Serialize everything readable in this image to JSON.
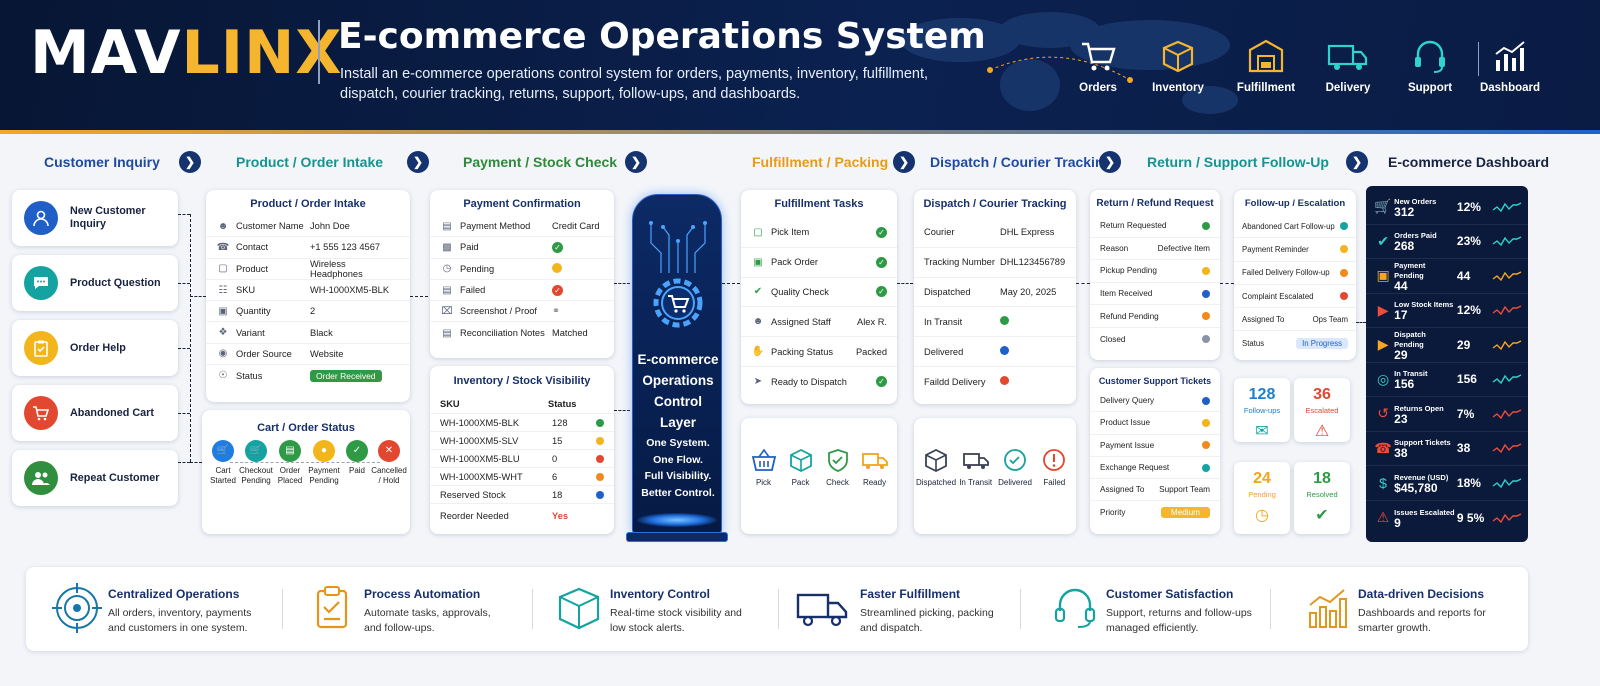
{
  "header": {
    "logo_a": "MAV",
    "logo_b": "LINX",
    "title": "E-commerce Operations System",
    "subtitle": "Install an e-commerce operations control system for orders, payments, inventory, fulfillment, dispatch, courier tracking, returns, support, follow-ups, and dashboards.",
    "icons": [
      {
        "label": "Orders",
        "icon": "cart-icon"
      },
      {
        "label": "Inventory",
        "icon": "box-icon"
      },
      {
        "label": "Fulfillment",
        "icon": "warehouse-icon"
      },
      {
        "label": "Delivery",
        "icon": "truck-icon"
      },
      {
        "label": "Support",
        "icon": "headset-icon"
      },
      {
        "label": "Dashboard",
        "icon": "bar-chart-icon"
      }
    ]
  },
  "stages": [
    {
      "label": "Customer Inquiry"
    },
    {
      "label": "Product / Order Intake"
    },
    {
      "label": "Payment / Stock Check"
    },
    {
      "label": "Fulfillment / Packing"
    },
    {
      "label": "Dispatch / Courier Tracking"
    },
    {
      "label": "Return / Support Follow-Up"
    },
    {
      "label": "E-commerce Dashboard"
    }
  ],
  "inquiry": [
    {
      "label": "New Customer Inquiry",
      "color": "#1f5fc7"
    },
    {
      "label": "Product Question",
      "color": "#14a3a0"
    },
    {
      "label": "Order Help",
      "color": "#f2b51b"
    },
    {
      "label": "Abandoned Cart",
      "color": "#e2472f"
    },
    {
      "label": "Repeat Customer",
      "color": "#2f8f3e"
    }
  ],
  "intake": {
    "title": "Product / Order Intake",
    "rows": [
      {
        "label": "Customer Name",
        "value": "John Doe"
      },
      {
        "label": "Contact",
        "value": "+1 555 123 4567"
      },
      {
        "label": "Product",
        "value": "Wireless Headphones"
      },
      {
        "label": "SKU",
        "value": "WH-1000XM5-BLK"
      },
      {
        "label": "Quantity",
        "value": "2"
      },
      {
        "label": "Variant",
        "value": "Black"
      },
      {
        "label": "Order Source",
        "value": "Website"
      },
      {
        "label": "Status",
        "value": "Order Received"
      }
    ]
  },
  "cart": {
    "title": "Cart / Order Status",
    "steps": [
      {
        "label": "Cart Started",
        "color": "#1f7ce0"
      },
      {
        "label": "Checkout Pending",
        "color": "#14a3a0"
      },
      {
        "label": "Order Placed",
        "color": "#2f9a46"
      },
      {
        "label": "Payment Pending",
        "color": "#f2b51b"
      },
      {
        "label": "Paid",
        "color": "#2f9a46"
      },
      {
        "label": "Cancelled / Hold",
        "color": "#e2472f"
      }
    ]
  },
  "payment": {
    "title": "Payment Confirmation",
    "rows": [
      {
        "label": "Payment Method",
        "value": "Credit Card"
      },
      {
        "label": "Paid",
        "value": ""
      },
      {
        "label": "Pending",
        "value": ""
      },
      {
        "label": "Failed",
        "value": ""
      },
      {
        "label": "Screenshot / Proof",
        "value": ""
      },
      {
        "label": "Reconciliation Notes",
        "value": "Matched"
      }
    ]
  },
  "inventory": {
    "title": "Inventory / Stock Visibility",
    "col_sku": "SKU",
    "col_status": "Status",
    "rows": [
      {
        "sku": "WH-1000XM5-BLK",
        "status": "128",
        "color": "#2f9a46"
      },
      {
        "sku": "WH-1000XM5-SLV",
        "status": "15",
        "color": "#f2b51b"
      },
      {
        "sku": "WH-1000XM5-BLU",
        "status": "0",
        "color": "#e2472f"
      },
      {
        "sku": "WH-1000XM5-WHT",
        "status": "6",
        "color": "#f28a1b"
      },
      {
        "sku": "Reserved Stock",
        "status": "18",
        "color": "#1f5fc7"
      }
    ],
    "reorder_label": "Reorder Needed",
    "reorder_value": "Yes"
  },
  "core": {
    "title": "E-commerce Operations Control Layer",
    "tagline": [
      "One System.",
      "One Flow.",
      "Full Visibility.",
      "Better Control."
    ]
  },
  "fulfillment": {
    "title": "Fulfillment Tasks",
    "rows": [
      {
        "label": "Pick Item",
        "value": ""
      },
      {
        "label": "Pack Order",
        "value": ""
      },
      {
        "label": "Quality Check",
        "value": ""
      },
      {
        "label": "Assigned Staff",
        "value": "Alex R."
      },
      {
        "label": "Packing Status",
        "value": "Packed"
      },
      {
        "label": "Ready to Dispatch",
        "value": ""
      }
    ],
    "steps": [
      "Pick",
      "Pack",
      "Check",
      "Ready"
    ]
  },
  "dispatch": {
    "title": "Dispatch / Courier Tracking",
    "rows": [
      {
        "label": "Courier",
        "value": "DHL Express"
      },
      {
        "label": "Tracking Number",
        "value": "DHL123456789"
      },
      {
        "label": "Dispatched",
        "value": "May 20, 2025"
      },
      {
        "label": "In Transit",
        "value": ""
      },
      {
        "label": "Delivered",
        "value": ""
      },
      {
        "label": "Faildd Delivery",
        "value": ""
      }
    ],
    "steps": [
      "Dispatched",
      "In Transit",
      "Delivered",
      "Failed"
    ]
  },
  "returns": {
    "title": "Return / Refund Request",
    "rows": [
      {
        "label": "Return Requested",
        "value": "",
        "color": "#2f9a46"
      },
      {
        "label": "Reason",
        "value": "Defective Item",
        "color": ""
      },
      {
        "label": "Pickup Pending",
        "value": "",
        "color": "#f2b51b"
      },
      {
        "label": "Item Received",
        "value": "",
        "color": "#1f5fc7"
      },
      {
        "label": "Refund Pending",
        "value": "",
        "color": "#f28a1b"
      },
      {
        "label": "Closed",
        "value": "",
        "color": "#8a93a6"
      }
    ]
  },
  "support": {
    "title": "Customer Support Tickets",
    "rows": [
      {
        "label": "Delivery Query",
        "value": "",
        "color": "#1f5fc7"
      },
      {
        "label": "Product Issue",
        "value": "",
        "color": "#f2b51b"
      },
      {
        "label": "Payment Issue",
        "value": "",
        "color": "#f28a1b"
      },
      {
        "label": "Exchange Request",
        "value": "",
        "color": "#14a3a0"
      },
      {
        "label": "Assigned To",
        "value": "Support Team",
        "color": ""
      },
      {
        "label": "Priority",
        "value": "Medium",
        "color": ""
      }
    ]
  },
  "followup": {
    "title": "Follow-up / Escalation",
    "rows": [
      {
        "label": "Abandoned Cart Follow-up",
        "value": "",
        "color": "#14a3a0"
      },
      {
        "label": "Payment Reminder",
        "value": "",
        "color": "#f2b51b"
      },
      {
        "label": "Failed Delivery Follow-up",
        "value": "",
        "color": "#f28a1b"
      },
      {
        "label": "Complaint Escalated",
        "value": "",
        "color": "#e2472f"
      },
      {
        "label": "Assigned To",
        "value": "Ops Team",
        "color": ""
      },
      {
        "label": "Status",
        "value": "In Progress",
        "color": ""
      }
    ]
  },
  "kpis": [
    {
      "value": "128",
      "label": "Follow-ups",
      "color": "#1a7fd0"
    },
    {
      "value": "36",
      "label": "Escalated",
      "color": "#e2472f"
    },
    {
      "value": "24",
      "label": "Pending",
      "color": "#f2a41b"
    },
    {
      "value": "18",
      "label": "Resolved",
      "color": "#2f9a46"
    }
  ],
  "dashboard": [
    {
      "label": "New Orders",
      "value": "312",
      "pct": "12%",
      "icon": "cart-icon",
      "color": "#2fd3c9"
    },
    {
      "label": "Orders Paid",
      "value": "268",
      "pct": "23%",
      "icon": "check-circle-icon",
      "color": "#2fd3c9"
    },
    {
      "label": "Payment Pending",
      "value": "44",
      "pct": "44",
      "icon": "box-icon",
      "color": "#f5a623"
    },
    {
      "label": "Low Stock Items",
      "value": "17",
      "pct": "12%",
      "icon": "truck-icon",
      "color": "#f24b3a"
    },
    {
      "label": "Dispatch Pending",
      "value": "29",
      "pct": "29",
      "icon": "truck-icon",
      "color": "#f5a623"
    },
    {
      "label": "In Transit",
      "value": "156",
      "pct": "156",
      "icon": "location-icon",
      "color": "#2fd3c9"
    },
    {
      "label": "Returns Open",
      "value": "23",
      "pct": "7%",
      "icon": "return-icon",
      "color": "#f24b3a"
    },
    {
      "label": "Support Tickets",
      "value": "38",
      "pct": "38",
      "icon": "headset-icon",
      "color": "#f24b3a"
    },
    {
      "label": "Revenue (USD)",
      "value": "$45,780",
      "pct": "18%",
      "icon": "dollar-icon",
      "color": "#2fd3c9"
    },
    {
      "label": "Issues Escalated",
      "value": "9",
      "pct": "9 5%",
      "icon": "warning-icon",
      "color": "#f24b3a"
    }
  ],
  "benefits": [
    {
      "title": "Centralized Operations",
      "desc": "All orders, inventory, payments and customers in one system.",
      "icon": "target-icon",
      "color": "#1877a8"
    },
    {
      "title": "Process Automation",
      "desc": "Automate tasks, approvals, and follow-ups.",
      "icon": "clipboard-icon",
      "color": "#e6951b"
    },
    {
      "title": "Inventory Control",
      "desc": "Real-time stock visibility and low stock alerts.",
      "icon": "box-icon",
      "color": "#14a3a0"
    },
    {
      "title": "Faster Fulfillment",
      "desc": "Streamlined picking, packing and dispatch.",
      "icon": "truck-icon",
      "color": "#17306a"
    },
    {
      "title": "Customer Satisfaction",
      "desc": "Support, returns and follow-ups managed efficiently.",
      "icon": "headset-icon",
      "color": "#14a3a0"
    },
    {
      "title": "Data-driven Decisions",
      "desc": "Dashboards and reports for smarter growth.",
      "icon": "bar-chart-icon",
      "color": "#e6951b"
    }
  ]
}
